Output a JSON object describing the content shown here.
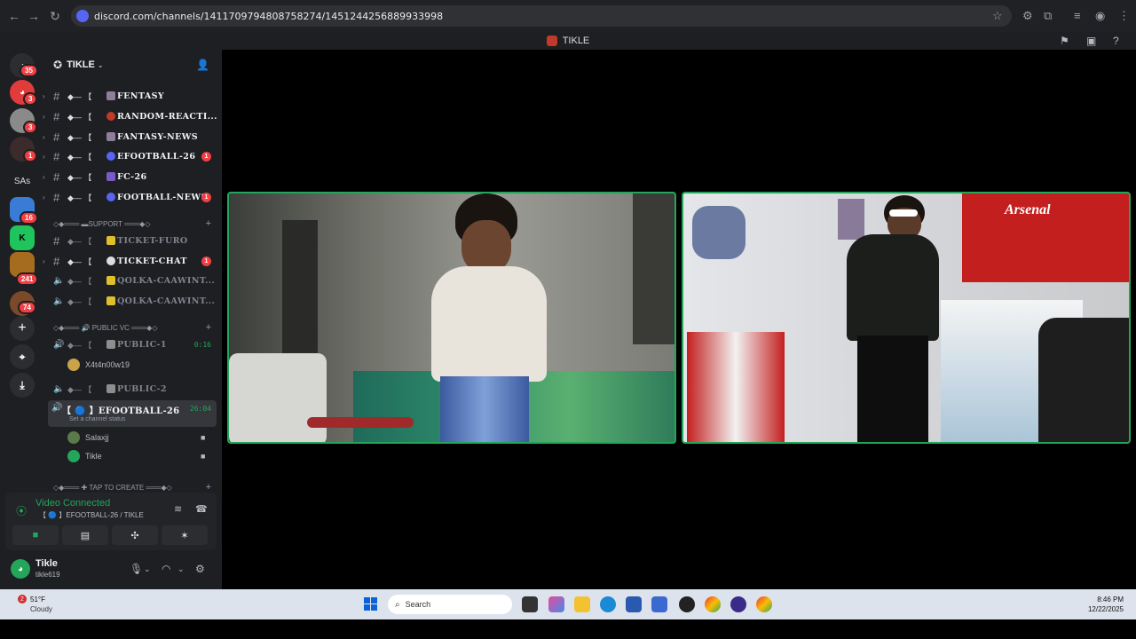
{
  "browser": {
    "url": "discord.com/channels/1411709794808758274/1451244256889933998"
  },
  "window": {
    "title": "TIKLE"
  },
  "server_rail": {
    "items": [
      {
        "name": "discord-home",
        "badge": "35"
      },
      {
        "name": "server-red",
        "badge": "3"
      },
      {
        "name": "server-avatar",
        "badge": "3"
      },
      {
        "name": "server-dark",
        "badge": "1"
      },
      {
        "name": "server-sas",
        "label": "SAs"
      },
      {
        "name": "server-green",
        "badge": "16"
      },
      {
        "name": "server-kick",
        "label": "K"
      },
      {
        "name": "server-group",
        "badge": "241"
      },
      {
        "name": "server-orange",
        "badge": "74"
      }
    ]
  },
  "sidebar": {
    "server_name": "TIKLE",
    "channels": [
      {
        "prefix": "◆— 【",
        "name": "FENTASY",
        "unread": ""
      },
      {
        "prefix": "◆— 【",
        "name": "RANDOM-REACTI...",
        "unread": ""
      },
      {
        "prefix": "◆— 【",
        "name": "FANTASY-NEWS",
        "unread": ""
      },
      {
        "prefix": "◆— 【",
        "name": "EFOOTBALL-26",
        "unread": "1"
      },
      {
        "prefix": "◆— 【",
        "name": "FC-26",
        "unread": ""
      },
      {
        "prefix": "◆— 【",
        "name": "FOOTBALL-NEWS",
        "unread": "1"
      }
    ],
    "support_category": "◇◆═══ ▬SUPPORT ═══◆◇",
    "support_channels": [
      {
        "prefix": "◆— 【",
        "name": "TICKET-FURO",
        "unread": ""
      },
      {
        "prefix": "◆— 【",
        "name": "TICKET-CHAT",
        "unread": "1"
      },
      {
        "prefix": "◆— 【",
        "name": "QOLKA-CAAWINT...",
        "unread": ""
      },
      {
        "prefix": "◆— 【",
        "name": "QOLKA-CAAWINT...",
        "unread": ""
      }
    ],
    "voice_category": "◇◆═══ 🔊 PUBLIC VC ═══◆◇",
    "voice_channels": [
      {
        "prefix": "◆— 【",
        "name": "PUBLIC-1",
        "timer": "0:16"
      },
      {
        "prefix": "◆— 【",
        "name": "PUBLIC-2",
        "timer": ""
      }
    ],
    "public1_user": "X4t4n00w19",
    "active_vc": {
      "name": "【 🔵 】EFOOTBALL-26",
      "timer": "26:04",
      "status": "Set a channel status"
    },
    "vc_users": [
      "Salaxjj",
      "Tikle"
    ],
    "create_category": "◇◆═══ ✚ TAP TO CREATE ═══◆◇"
  },
  "voice_panel": {
    "title": "Video Connected",
    "subtitle": "【 🔵 】EFOOTBALL-26 / TIKLE"
  },
  "user_panel": {
    "name": "Tikle",
    "tag": "tikle619"
  },
  "taskbar": {
    "weather_temp": "51°F",
    "weather_desc": "Cloudy",
    "weather_badge": "2",
    "search_placeholder": "Search",
    "time": "8:46 PM",
    "date": "12/22/2025"
  },
  "colors": {
    "accent_green": "#23a55a",
    "badge_red": "#f23f43",
    "blurple": "#5865f2"
  }
}
